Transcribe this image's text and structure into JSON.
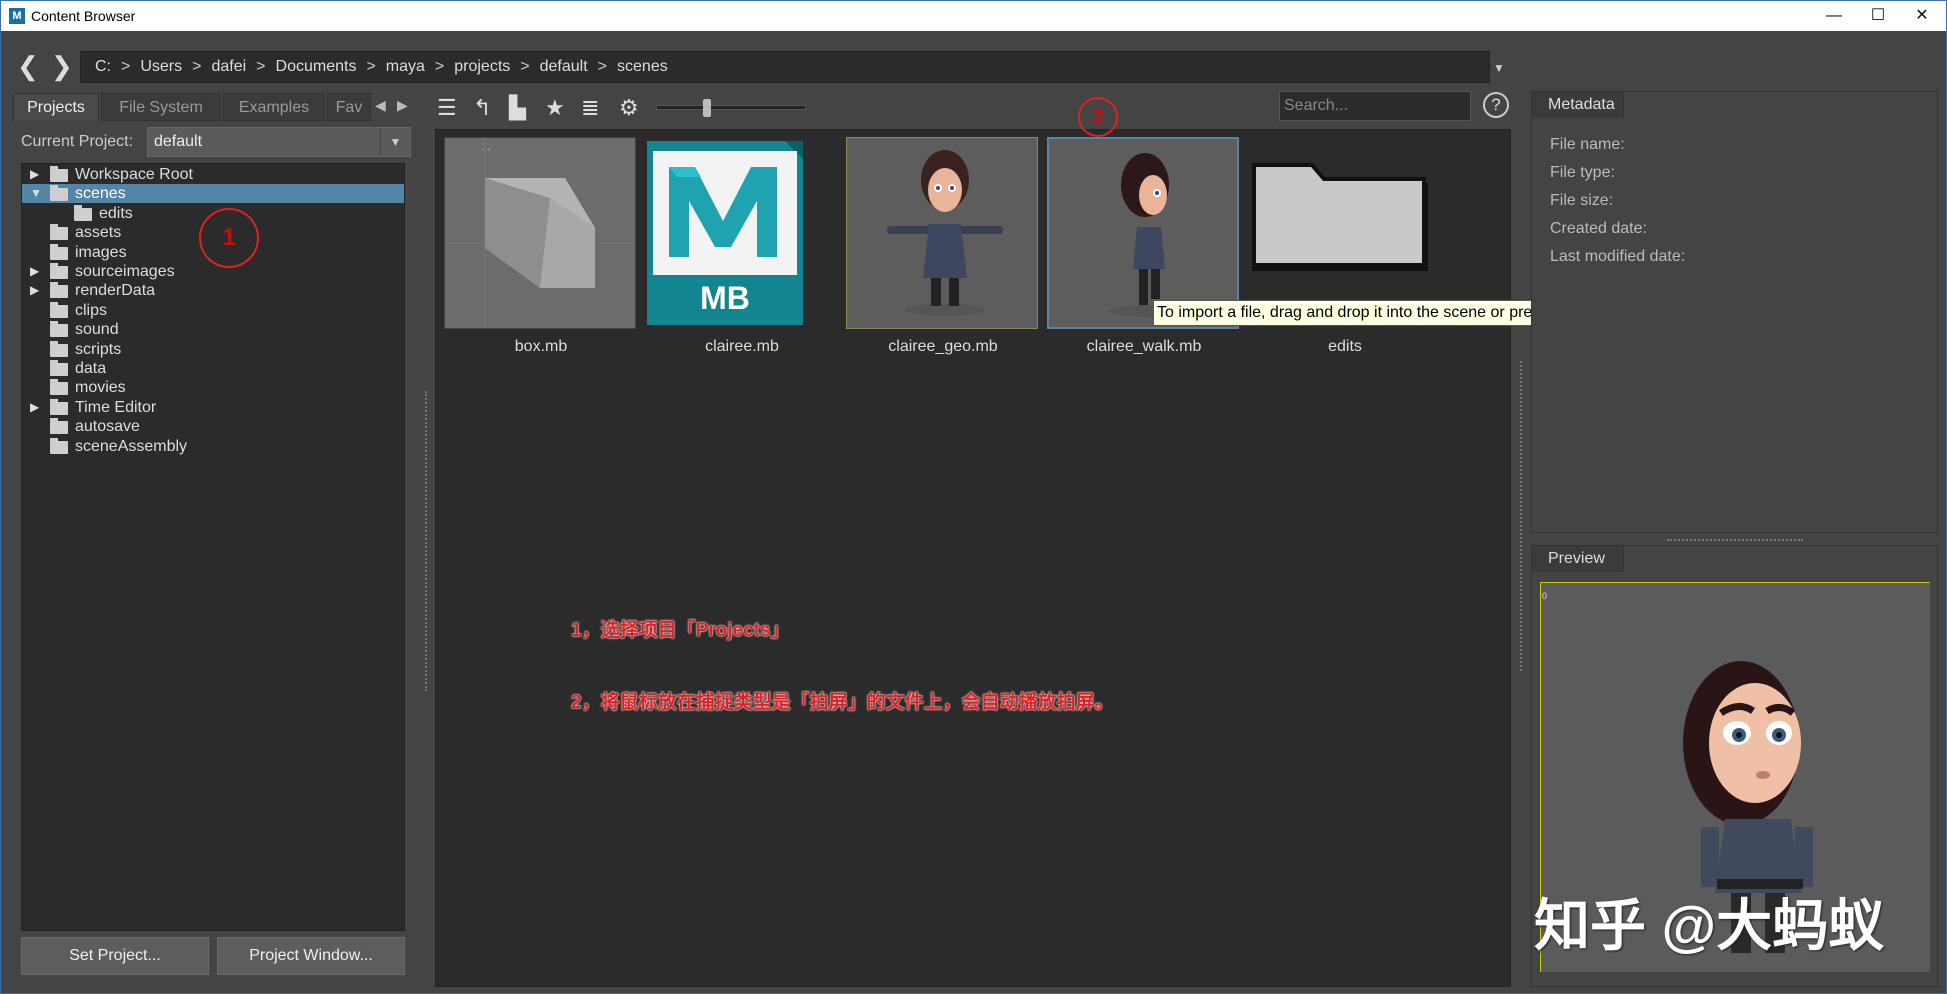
{
  "window": {
    "title": "Content Browser",
    "app_icon": "M",
    "minimize": "—",
    "maximize": "☐",
    "close": "✕"
  },
  "nav": {
    "back": "❮",
    "forward": "❯",
    "path": [
      "C:",
      "Users",
      "dafei",
      "Documents",
      "maya",
      "projects",
      "default",
      "scenes"
    ],
    "separator": ">",
    "dropdown": "▼"
  },
  "tabs": [
    {
      "label": "Projects",
      "active": true
    },
    {
      "label": "File System"
    },
    {
      "label": "Examples"
    },
    {
      "label": "Fav"
    }
  ],
  "tab_scroll": {
    "left": "◀",
    "right": "▶"
  },
  "project": {
    "label": "Current Project:",
    "value": "default"
  },
  "tree": [
    {
      "label": "Workspace Root",
      "expandable": true,
      "expanded": false
    },
    {
      "label": "scenes",
      "expandable": true,
      "expanded": true,
      "selected": true
    },
    {
      "label": "edits",
      "child": true
    },
    {
      "label": "assets"
    },
    {
      "label": "images"
    },
    {
      "label": "sourceimages",
      "expandable": true
    },
    {
      "label": "renderData",
      "expandable": true
    },
    {
      "label": "clips"
    },
    {
      "label": "sound"
    },
    {
      "label": "scripts"
    },
    {
      "label": "data"
    },
    {
      "label": "movies"
    },
    {
      "label": "Time Editor",
      "expandable": true
    },
    {
      "label": "autosave"
    },
    {
      "label": "sceneAssembly"
    }
  ],
  "buttons": {
    "set_project": "Set Project...",
    "project_window": "Project Window..."
  },
  "toolbar": {
    "search_placeholder": "Search...",
    "help": "?"
  },
  "files": [
    {
      "name": "box.mb",
      "kind": "cube"
    },
    {
      "name": "clairee.mb",
      "kind": "maya",
      "badge": "MB"
    },
    {
      "name": "clairee_geo.mb",
      "kind": "character"
    },
    {
      "name": "clairee_walk.mb",
      "kind": "character-walk",
      "selected": true
    },
    {
      "name": "edits",
      "kind": "folder"
    }
  ],
  "tooltip": "To import a file, drag and drop it into the scene or press the right mouse button for import options",
  "annotations": {
    "marker1": "1",
    "marker2": "2",
    "line1": "1，选择项目「Projects」",
    "line2": "2，将鼠标放在捕捉类型是「拍屏」的文件上，会自动播放拍屏。"
  },
  "metadata": {
    "title": "Metadata",
    "fields": [
      "File name:",
      "File type:",
      "File size:",
      "Created date:",
      "Last modified date:"
    ]
  },
  "preview": {
    "title": "Preview",
    "frame_label": "0"
  },
  "watermark": "知乎 @大蚂蚁"
}
